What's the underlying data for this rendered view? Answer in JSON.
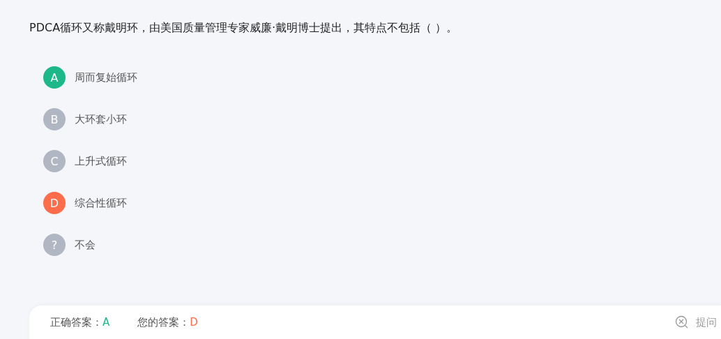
{
  "question": "PDCA循环又称戴明环，由美国质量管理专家威廉·戴明博士提出，其特点不包括（    ）。",
  "options": [
    {
      "letter": "A",
      "text": "周而复始循环",
      "color": "#1db88a"
    },
    {
      "letter": "B",
      "text": "大环套小环",
      "color": "#b0b7c3"
    },
    {
      "letter": "C",
      "text": "上升式循环",
      "color": "#b0b7c3"
    },
    {
      "letter": "D",
      "text": "综合性循环",
      "color": "#fd6d4b"
    },
    {
      "letter": "?",
      "text": "不会",
      "color": "#b0b7c3"
    }
  ],
  "answer_bar": {
    "correct_label": "正确答案：",
    "correct_value": "A",
    "your_label": "您的答案：",
    "your_value": "D",
    "ask_button": "提问"
  }
}
